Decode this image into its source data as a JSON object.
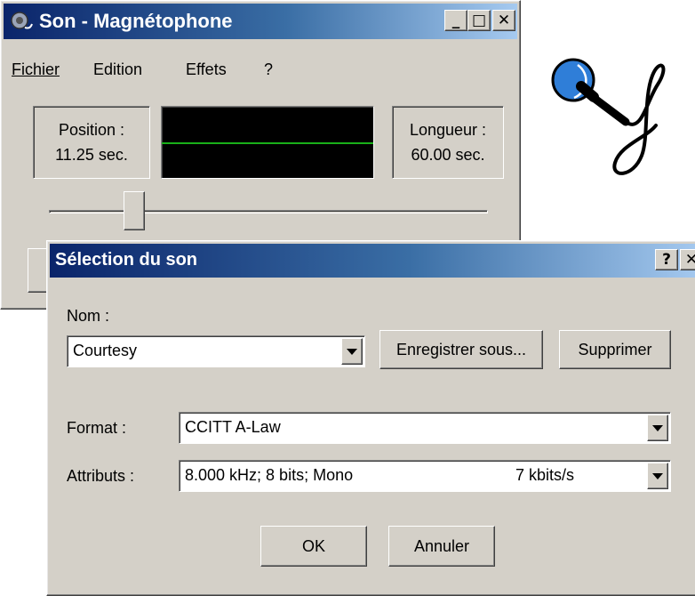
{
  "recorder": {
    "title": "Son - Magnétophone",
    "window_buttons": {
      "minimize": "_",
      "maximize": "□",
      "close": "✕"
    },
    "menu": [
      "Fichier",
      "Edition",
      "Effets",
      "?"
    ],
    "position_label": "Position :",
    "position_value": "11.25 sec.",
    "length_label": "Longueur :",
    "length_value": "60.00 sec."
  },
  "dialog": {
    "title": "Sélection du son",
    "help": "?",
    "close": "✕",
    "name_label": "Nom :",
    "name_value": "Courtesy",
    "save_as": "Enregistrer sous...",
    "delete": "Supprimer",
    "format_label": "Format :",
    "format_value": "CCITT A-Law",
    "attributes_label": "Attributs :",
    "attributes_value": "8.000 kHz; 8 bits; Mono",
    "attributes_rate": "7 kbits/s",
    "ok": "OK",
    "cancel": "Annuler"
  },
  "colors": {
    "titlebar_start": "#0a246a",
    "titlebar_end": "#a6caf0",
    "face": "#d4d0c8",
    "scope_line": "#19b019",
    "mic_head": "#2f7ed8"
  },
  "icons": [
    "speaker-icon",
    "microphone-icon",
    "dropdown-arrow-icon"
  ]
}
